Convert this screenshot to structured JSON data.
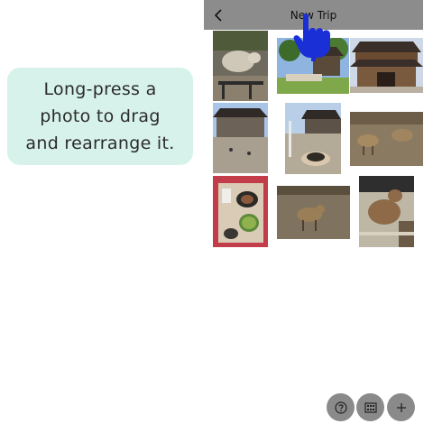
{
  "hint": {
    "lines": [
      "Long-press a",
      "photo to drag",
      "and rearrange it."
    ]
  },
  "app": {
    "title": "New Trip",
    "back_icon": "chevron-left-icon",
    "photos": [
      {
        "name": "sheep-photo"
      },
      {
        "name": "temple-garden-photo"
      },
      {
        "name": "temple-gate-photo"
      },
      {
        "name": "temple-courtyard-photo"
      },
      {
        "name": "hand-bowl-photo"
      },
      {
        "name": "deer-field-photo"
      },
      {
        "name": "tea-set-photo"
      },
      {
        "name": "deer-grass-photo"
      },
      {
        "name": "deer-closeup-photo"
      }
    ],
    "bottom_buttons": [
      "help-icon",
      "film-icon",
      "plus-icon"
    ]
  },
  "colors": {
    "hint_bg": "#d7f2ea",
    "topbar": "#8c8c8c",
    "hand": "#1a2fd6",
    "fab": "#8a8a8a"
  }
}
